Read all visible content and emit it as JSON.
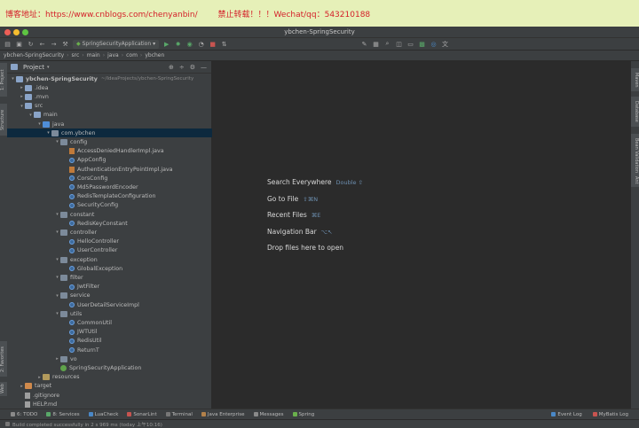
{
  "banner": {
    "text": "博客地址：https://www.cnblogs.com/chenyanbin/        禁止转载！！！Wechat/qq：543210188"
  },
  "window": {
    "title": "ybchen-SpringSecurity"
  },
  "toolbar": {
    "run_config": "SpringSecurityApplication"
  },
  "breadcrumbs": [
    "ybchen-SpringSecurity",
    "src",
    "main",
    "java",
    "com",
    "ybchen"
  ],
  "left_tool_tabs": [
    "1: Project",
    "Structure",
    "2: Favorites",
    "Web"
  ],
  "right_tool_tabs": [
    "Maven",
    "Database",
    "Bean Validation",
    "Ant"
  ],
  "project_panel": {
    "title": "Project",
    "tree": [
      {
        "label": "ybchen-SpringSecurity",
        "path": "~/IdeaProjects/ybchen-SpringSecurity",
        "icon": "folder-icon",
        "depth": 0,
        "expanded": true,
        "bold": true
      },
      {
        "label": ".idea",
        "icon": "folder-icon",
        "depth": 1,
        "expanded": false
      },
      {
        "label": ".mvn",
        "icon": "folder-icon",
        "depth": 1,
        "expanded": false
      },
      {
        "label": "src",
        "icon": "folder-icon",
        "depth": 1,
        "expanded": true
      },
      {
        "label": "main",
        "icon": "folder-icon",
        "depth": 2,
        "expanded": true
      },
      {
        "label": "java",
        "icon": "source-folder-icon",
        "depth": 3,
        "expanded": true
      },
      {
        "label": "com.ybchen",
        "icon": "package-icon",
        "depth": 4,
        "expanded": true,
        "selected": true
      },
      {
        "label": "config",
        "icon": "package-icon",
        "depth": 5,
        "expanded": true
      },
      {
        "label": "AccessDeniedHandlerImpl.java",
        "icon": "java-file-icon",
        "depth": 6
      },
      {
        "label": "AppConfig",
        "icon": "class-icon",
        "depth": 6
      },
      {
        "label": "AuthenticationEntryPointImpl.java",
        "icon": "java-file-icon",
        "depth": 6
      },
      {
        "label": "CorsConfig",
        "icon": "class-icon",
        "depth": 6
      },
      {
        "label": "Md5PasswordEncoder",
        "icon": "class-icon",
        "depth": 6
      },
      {
        "label": "RedisTemplateConfiguration",
        "icon": "class-icon",
        "depth": 6
      },
      {
        "label": "SecurityConfig",
        "icon": "class-icon",
        "depth": 6
      },
      {
        "label": "constant",
        "icon": "package-icon",
        "depth": 5,
        "expanded": true
      },
      {
        "label": "RedisKeyConstant",
        "icon": "class-icon",
        "depth": 6
      },
      {
        "label": "controller",
        "icon": "package-icon",
        "depth": 5,
        "expanded": true
      },
      {
        "label": "HelloController",
        "icon": "class-icon",
        "depth": 6
      },
      {
        "label": "UserController",
        "icon": "class-icon",
        "depth": 6
      },
      {
        "label": "exception",
        "icon": "package-icon",
        "depth": 5,
        "expanded": true
      },
      {
        "label": "GlobalException",
        "icon": "class-icon",
        "depth": 6
      },
      {
        "label": "filter",
        "icon": "package-icon",
        "depth": 5,
        "expanded": true
      },
      {
        "label": "JwtFilter",
        "icon": "class-icon",
        "depth": 6
      },
      {
        "label": "service",
        "icon": "package-icon",
        "depth": 5,
        "expanded": true
      },
      {
        "label": "UserDetailServiceImpl",
        "icon": "class-icon",
        "depth": 6
      },
      {
        "label": "utils",
        "icon": "package-icon",
        "depth": 5,
        "expanded": true
      },
      {
        "label": "CommonUtil",
        "icon": "class-icon",
        "depth": 6
      },
      {
        "label": "JWTUtil",
        "icon": "class-icon",
        "depth": 6
      },
      {
        "label": "RedisUtil",
        "icon": "class-icon",
        "depth": 6
      },
      {
        "label": "ReturnT",
        "icon": "class-icon",
        "depth": 6
      },
      {
        "label": "vo",
        "icon": "package-icon",
        "depth": 5,
        "expanded": false
      },
      {
        "label": "SpringSecurityApplication",
        "icon": "spring-class-icon",
        "depth": 5
      },
      {
        "label": "resources",
        "icon": "resources-folder-icon",
        "depth": 3,
        "expanded": false
      },
      {
        "label": "target",
        "icon": "target-folder-icon",
        "depth": 1,
        "expanded": false
      },
      {
        "label": ".gitignore",
        "icon": "file-icon",
        "depth": 1
      },
      {
        "label": "HELP.md",
        "icon": "file-icon",
        "depth": 1
      }
    ]
  },
  "editor_hints": [
    {
      "label": "Search Everywhere",
      "shortcut": "Double ⇧"
    },
    {
      "label": "Go to File",
      "shortcut": "⇧⌘N"
    },
    {
      "label": "Recent Files",
      "shortcut": "⌘E"
    },
    {
      "label": "Navigation Bar",
      "shortcut": "⌥↖"
    },
    {
      "label": "Drop files here to open",
      "shortcut": ""
    }
  ],
  "bottom_tabs": [
    "6: TODO",
    "8: Services",
    "LuaCheck",
    "SonarLint",
    "Terminal",
    "Java Enterprise",
    "Messages",
    "Spring"
  ],
  "bottom_right_tabs": [
    "Event Log",
    "MyBatis Log"
  ],
  "status": {
    "text": "Build completed successfully in 2 s 969 ms (today 上午10:16)"
  },
  "colors": {
    "banner_bg": "#e6f0b8",
    "banner_text": "#d4202a",
    "ide_bg": "#2b2b2b",
    "panel_bg": "#3c3f41",
    "selection": "#0d293e"
  }
}
